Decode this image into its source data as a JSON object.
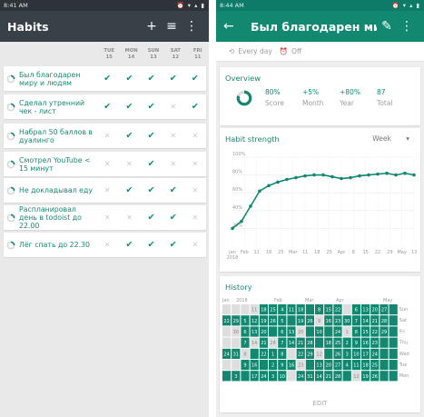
{
  "left": {
    "status": {
      "time": "8:41 AM",
      "icons": "⏰ ▾ ▴ ▮"
    },
    "appbar": {
      "title": "Habits",
      "add": "+",
      "filter": "≡",
      "menu": "⋮"
    },
    "days": [
      {
        "dow": "TUE",
        "num": "15"
      },
      {
        "dow": "MON",
        "num": "14"
      },
      {
        "dow": "SUN",
        "num": "13"
      },
      {
        "dow": "SAT",
        "num": "12"
      },
      {
        "dow": "FRI",
        "num": "11"
      }
    ],
    "habits": [
      {
        "name": "Был благодарен миру и людям",
        "checks": [
          1,
          1,
          1,
          1,
          1
        ]
      },
      {
        "name": "Сделал утренний чек - лист",
        "checks": [
          1,
          1,
          1,
          0,
          1
        ]
      },
      {
        "name": "Набрал 50 баллов в дуалинго",
        "checks": [
          0,
          1,
          1,
          0,
          0
        ]
      },
      {
        "name": "Смотрел YouTube < 15 минут",
        "checks": [
          0,
          0,
          1,
          0,
          0
        ]
      },
      {
        "name": "Не докладывал еду",
        "checks": [
          0,
          1,
          1,
          1,
          0
        ]
      },
      {
        "name": "Распланировал день в todoist до 22.00",
        "checks": [
          0,
          0,
          1,
          1,
          0
        ]
      },
      {
        "name": "Лёг спать до 22.30",
        "checks": [
          0,
          1,
          1,
          1,
          0
        ]
      }
    ],
    "check_glyph": "✔",
    "cross_glyph": "✕"
  },
  "right": {
    "status": {
      "time": "8:44 AM",
      "icons": "⏰ ▾ ▴ ▮"
    },
    "appbar": {
      "back": "←",
      "title": "Был благодарен миру и людям",
      "edit": "✎",
      "menu": "⋮"
    },
    "freq": {
      "repeat_icon": "⟲",
      "label": "Every day",
      "reminder_icon": "⏰",
      "reminder": "Off"
    },
    "overview": {
      "title": "Overview",
      "score_fraction": 0.8,
      "items": [
        {
          "value": "80%",
          "label": "Score"
        },
        {
          "value": "+5%",
          "label": "Month"
        },
        {
          "value": "+80%",
          "label": "Year"
        },
        {
          "value": "87",
          "label": "Total"
        }
      ]
    },
    "strength": {
      "title": "Habit strength",
      "period": "Week",
      "period_arrow": "▾"
    },
    "history": {
      "title": "History",
      "months": [
        "Jan",
        "2018",
        "Feb",
        "Mar",
        "Apr",
        "May"
      ],
      "weekdays": [
        "Sun",
        "Sat",
        "Fri",
        "Thu",
        "Wed",
        "Tue",
        "Mon"
      ],
      "edit": "EDIT"
    },
    "colors": {
      "accent": "#128871",
      "muted": "#dcdcdc"
    }
  },
  "chart_data": {
    "type": "line",
    "title": "",
    "xlabel": "",
    "ylabel": "",
    "categories": [
      "Jan\n2018",
      "Feb",
      "11",
      "18",
      "25",
      "Mar",
      "11",
      "18",
      "25",
      "Apr",
      "8",
      "15",
      "22",
      "29",
      "May",
      "13"
    ],
    "series": [
      {
        "values": [
          20,
          28,
          45,
          62,
          68,
          72,
          75,
          77,
          79,
          80,
          80,
          78,
          76,
          77,
          79,
          80,
          81,
          82,
          80,
          82,
          80
        ]
      }
    ],
    "yticks": [
      "20%",
      "40%",
      "60%",
      "80%",
      "100%"
    ],
    "ylim": [
      0,
      100
    ],
    "grid": true
  }
}
